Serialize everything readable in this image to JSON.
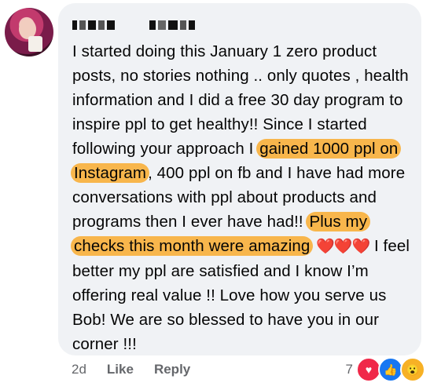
{
  "comment": {
    "text_before_h1": "I started doing this January 1 zero product posts, no stories nothing .. only quotes , health information and I did a free 30 day program to inspire ppl to get healthy!! Since I started following your approach I ",
    "highlight_1": "gained 1000 ppl on Instagram",
    "text_between": ", 400 ppl on fb and I have had more conversations with ppl about products and programs then I ever have had!! ",
    "highlight_2": "Plus my checks this month were amazing",
    "hearts": "❤️❤️❤️",
    "text_after": " I feel better my ppl are satisfied and I know I’m offering real value !! Love how you serve us Bob! We are so blessed to have you in our corner !!!"
  },
  "footer": {
    "time": "2d",
    "like_label": "Like",
    "reply_label": "Reply"
  },
  "reactions": {
    "count": "7",
    "icons": [
      "love-icon",
      "like-icon",
      "wow-icon"
    ]
  },
  "colors": {
    "bubble_bg": "#f0f2f5",
    "highlight": "#f8b64c",
    "love": "#f02849",
    "like": "#1877f2",
    "wow": "#f7b125"
  }
}
